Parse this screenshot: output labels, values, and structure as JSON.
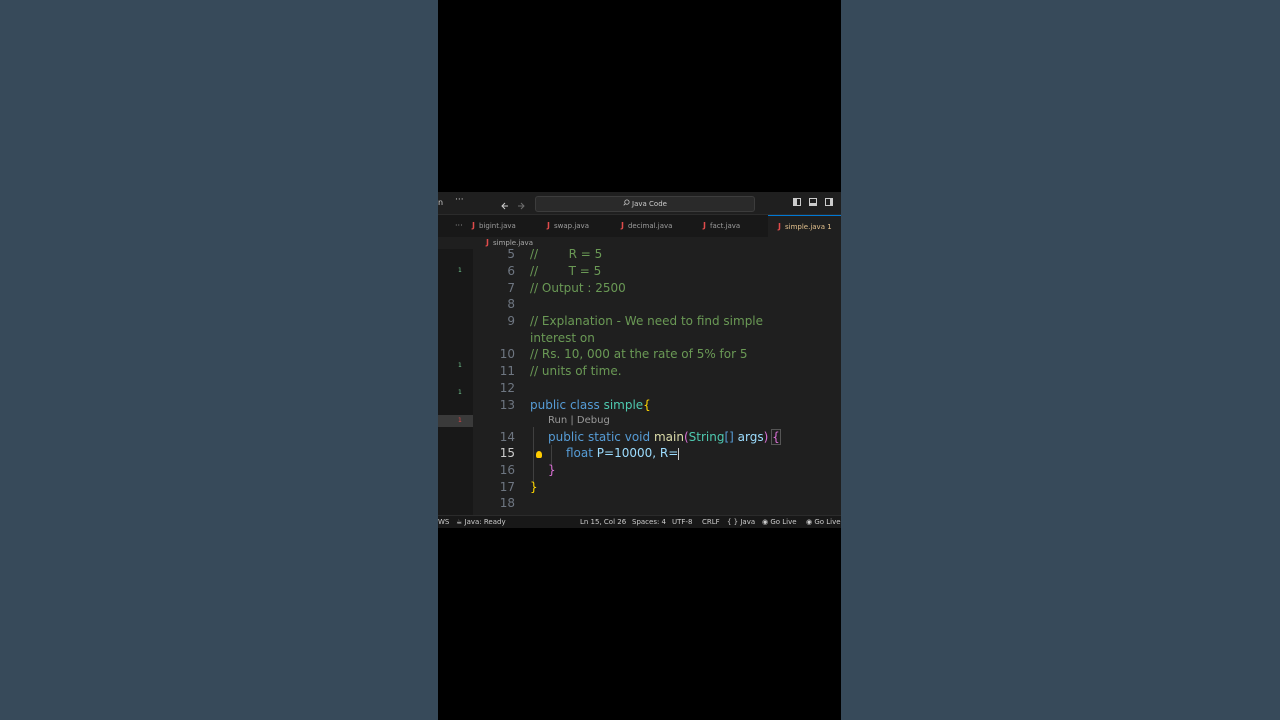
{
  "titlebar": {
    "left_fragment": "n",
    "more": "···",
    "back_icon": "arrow-left",
    "forward_icon": "arrow-right",
    "search_label": "Java Code"
  },
  "tabs": [
    {
      "label": "bigint.java",
      "active": false
    },
    {
      "label": "swap.java",
      "active": false
    },
    {
      "label": "decimal.java",
      "active": false
    },
    {
      "label": "fact.java",
      "active": false
    },
    {
      "label": "simple.java 1",
      "active": true
    }
  ],
  "tabs_more": "···",
  "breadcrumb": "simple.java",
  "gutter_marks": [
    "1",
    "1",
    "1",
    "1"
  ],
  "code": {
    "lines": [
      {
        "n": "5",
        "text": "//        R = 5"
      },
      {
        "n": "6",
        "text": "//        T = 5"
      },
      {
        "n": "7",
        "text": "// Output : 2500"
      },
      {
        "n": "8",
        "text": ""
      },
      {
        "n": "9",
        "text": "// Explanation - We need to find simple"
      },
      {
        "n": "",
        "text": "interest on"
      },
      {
        "n": "10",
        "text": "// Rs. 10, 000 at the rate of 5% for 5"
      },
      {
        "n": "11",
        "text": "// units of time."
      },
      {
        "n": "12",
        "text": ""
      },
      {
        "n": "13",
        "kw1": "public",
        "kw2": "class",
        "cls": "simple",
        "brace": "{"
      },
      {
        "n": "14",
        "kw1": "public",
        "kw2": "static",
        "kw3": "void",
        "fn": "main",
        "p1": "(",
        "cls": "String",
        "arr": "[]",
        "var": "args",
        "p2": ")",
        "brace": "{"
      },
      {
        "n": "15",
        "kw": "float",
        "rest": "P=10000, R="
      },
      {
        "n": "16",
        "brace": "}"
      },
      {
        "n": "17",
        "brace": "}"
      },
      {
        "n": "18",
        "text": ""
      }
    ],
    "codelens": "Run | Debug"
  },
  "statusbar": {
    "left_fragment": "WS",
    "java_status": "Java: Ready",
    "position": "Ln 15, Col 26",
    "spaces": "Spaces: 4",
    "encoding": "UTF-8",
    "eol": "CRLF",
    "language": "{ } Java",
    "golive1": "Go Live",
    "golive2": "Go Live"
  }
}
